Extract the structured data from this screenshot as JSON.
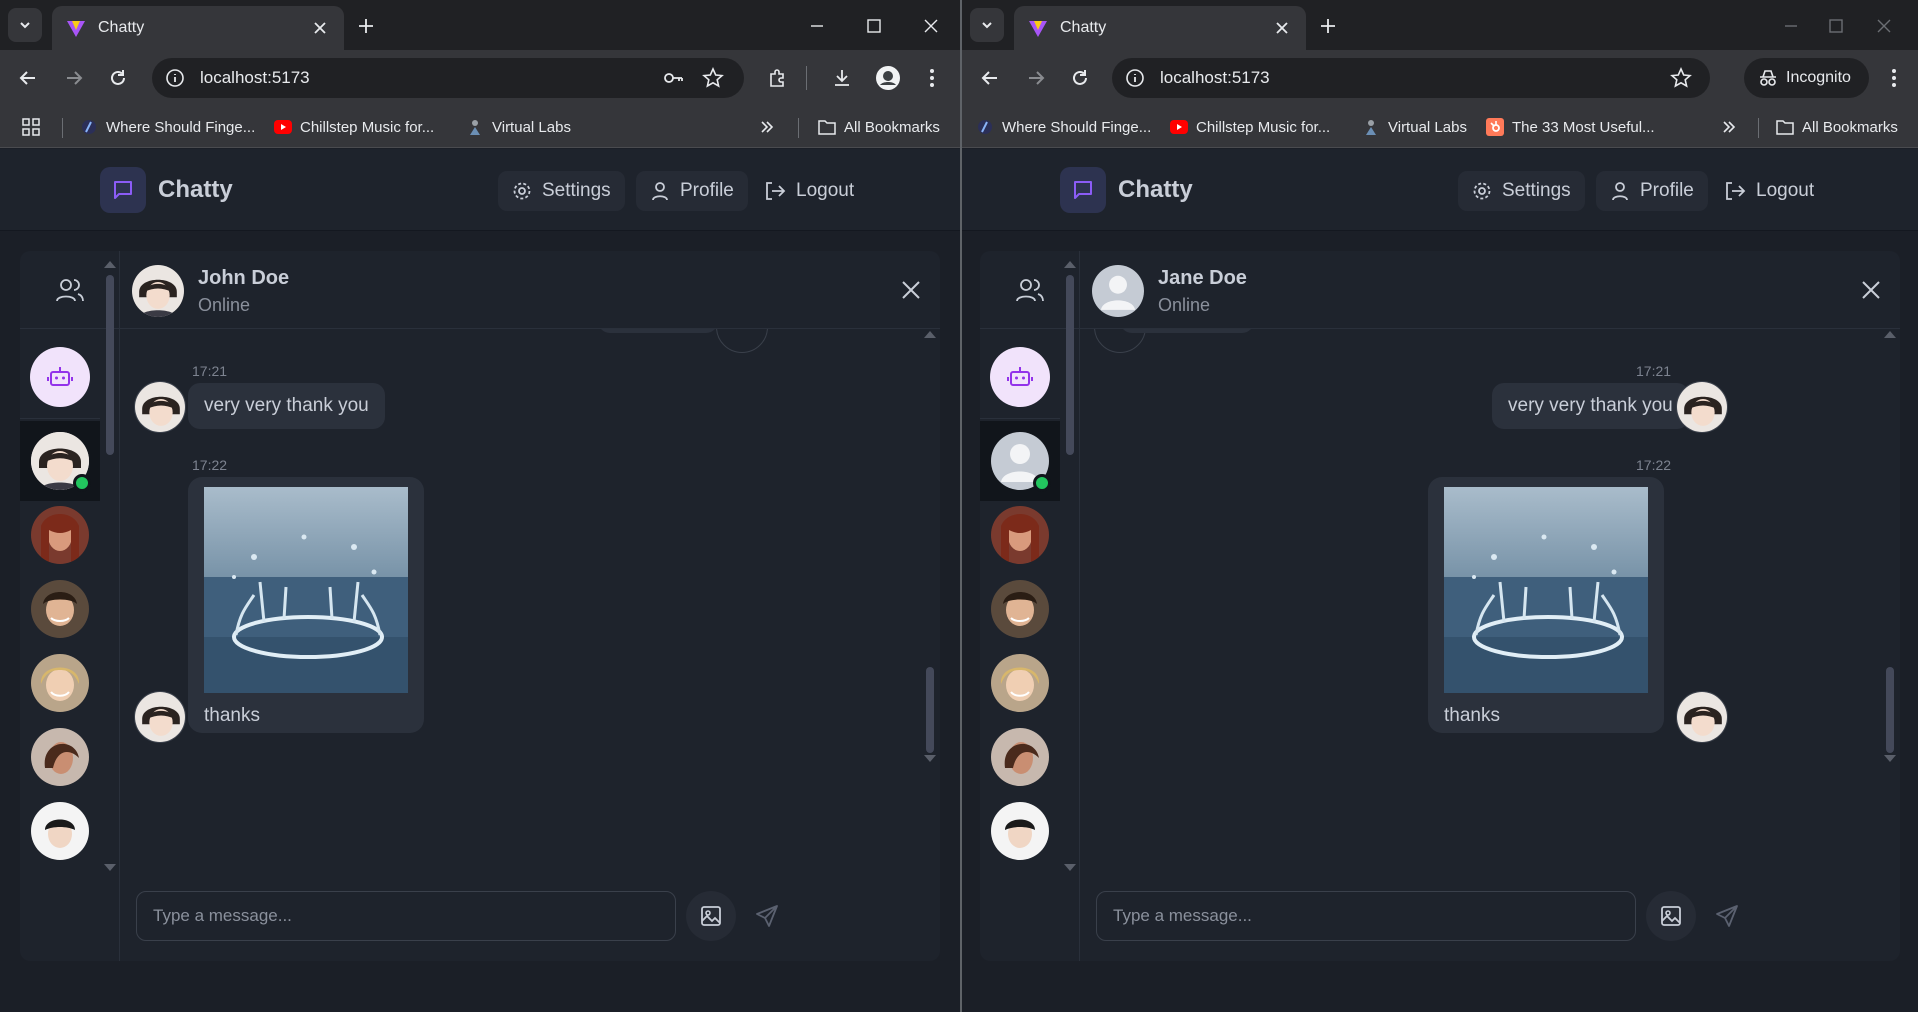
{
  "left": {
    "tab_title": "Chatty",
    "url": "localhost:5173",
    "bookmarks": [
      {
        "label": "Where Should Finge..."
      },
      {
        "label": "Chillstep Music for..."
      },
      {
        "label": "Virtual Labs"
      }
    ],
    "all_bookmarks": "All Bookmarks",
    "app": {
      "brand": "Chatty",
      "settings": "Settings",
      "profile": "Profile",
      "logout": "Logout"
    },
    "chat": {
      "name": "John Doe",
      "status": "Online",
      "messages": [
        {
          "time": "17:21",
          "text": "very very thank you"
        },
        {
          "time": "17:22",
          "text": "thanks"
        }
      ],
      "placeholder": "Type a message..."
    }
  },
  "right": {
    "tab_title": "Chatty",
    "url": "localhost:5173",
    "incognito": "Incognito",
    "bookmarks": [
      {
        "label": "Where Should Finge..."
      },
      {
        "label": "Chillstep Music for..."
      },
      {
        "label": "Virtual Labs"
      },
      {
        "label": "The 33 Most Useful..."
      }
    ],
    "all_bookmarks": "All Bookmarks",
    "app": {
      "brand": "Chatty",
      "settings": "Settings",
      "profile": "Profile",
      "logout": "Logout"
    },
    "chat": {
      "name": "Jane Doe",
      "status": "Online",
      "messages": [
        {
          "time": "17:21",
          "text": "very very thank you"
        },
        {
          "time": "17:22",
          "text": "thanks"
        }
      ],
      "placeholder": "Type a message..."
    }
  },
  "colors": {
    "accent": "#8b5cf6",
    "online": "#22c55e",
    "background": "#1b1f27",
    "bubble": "#2b313c"
  }
}
